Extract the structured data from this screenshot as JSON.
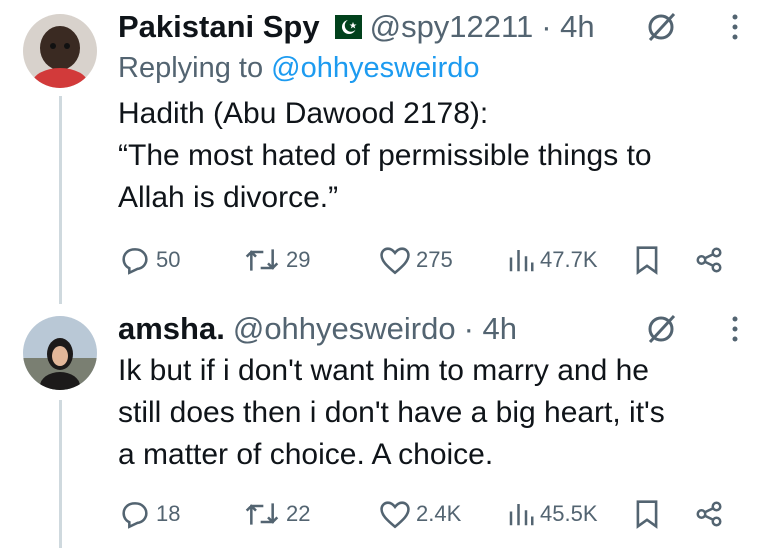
{
  "tweets": [
    {
      "name": "Pakistani Spy",
      "flag_icon": "pakistan-flag-icon",
      "handle": "@spy12211",
      "time": "· 4h",
      "reply_prefix": "Replying to",
      "reply_to": "@ohhyesweirdo",
      "lines": [
        "Hadith (Abu Dawood 2178):",
        "“The most hated of permissible things to",
        "Allah is divorce.”"
      ],
      "stats": {
        "replies": "50",
        "retweets": "29",
        "likes": "275",
        "views": "47.7K"
      }
    },
    {
      "name": "amsha.",
      "handle": "@ohhyesweirdo",
      "time": "· 4h",
      "lines": [
        "Ik but if i don't want him to marry and he",
        "still does then i don't have a big heart, it's",
        "a matter of choice. A choice."
      ],
      "stats": {
        "replies": "18",
        "retweets": "22",
        "likes": "2.4K",
        "views": "45.5K"
      }
    }
  ],
  "colors": {
    "text": "#0f1419",
    "secondary": "#536471",
    "link": "#1d9bf0",
    "flag_green": "#01411c"
  }
}
